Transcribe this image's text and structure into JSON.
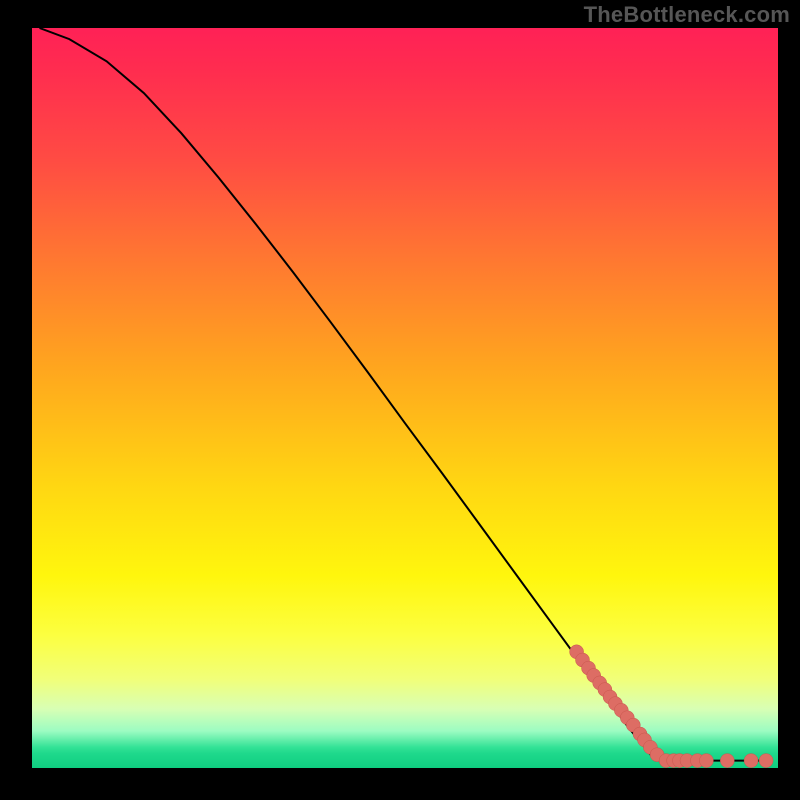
{
  "watermark": "TheBottleneck.com",
  "colors": {
    "grad_top": "#ff2156",
    "grad_mid": "#ffe012",
    "grad_low": "#33e296",
    "point": "#dd6d64",
    "line": "#000000",
    "bg": "#000000"
  },
  "chart_data": {
    "type": "line",
    "title": "",
    "xlabel": "",
    "ylabel": "",
    "xlim": [
      0,
      100
    ],
    "ylim": [
      0,
      100
    ],
    "grid": false,
    "legend": false,
    "curve": [
      {
        "x": 1,
        "y": 100
      },
      {
        "x": 5,
        "y": 98.5
      },
      {
        "x": 10,
        "y": 95.5
      },
      {
        "x": 15,
        "y": 91.2
      },
      {
        "x": 20,
        "y": 85.8
      },
      {
        "x": 25,
        "y": 79.8
      },
      {
        "x": 30,
        "y": 73.5
      },
      {
        "x": 35,
        "y": 67.0
      },
      {
        "x": 40,
        "y": 60.3
      },
      {
        "x": 45,
        "y": 53.5
      },
      {
        "x": 50,
        "y": 46.6
      },
      {
        "x": 55,
        "y": 39.8
      },
      {
        "x": 60,
        "y": 32.9
      },
      {
        "x": 65,
        "y": 26.0
      },
      {
        "x": 70,
        "y": 19.1
      },
      {
        "x": 75,
        "y": 12.2
      },
      {
        "x": 80,
        "y": 5.4
      },
      {
        "x": 83,
        "y": 1.7
      },
      {
        "x": 84.5,
        "y": 1.0
      },
      {
        "x": 90,
        "y": 1.0
      },
      {
        "x": 95,
        "y": 1.0
      },
      {
        "x": 99,
        "y": 1.0
      }
    ],
    "points": [
      {
        "x": 73.0,
        "y": 15.7
      },
      {
        "x": 73.8,
        "y": 14.6
      },
      {
        "x": 74.6,
        "y": 13.5
      },
      {
        "x": 75.3,
        "y": 12.5
      },
      {
        "x": 76.1,
        "y": 11.5
      },
      {
        "x": 76.8,
        "y": 10.6
      },
      {
        "x": 77.5,
        "y": 9.6
      },
      {
        "x": 78.2,
        "y": 8.7
      },
      {
        "x": 79.0,
        "y": 7.8
      },
      {
        "x": 79.8,
        "y": 6.8
      },
      {
        "x": 80.6,
        "y": 5.8
      },
      {
        "x": 81.5,
        "y": 4.6
      },
      {
        "x": 82.1,
        "y": 3.8
      },
      {
        "x": 82.9,
        "y": 2.8
      },
      {
        "x": 83.8,
        "y": 1.8
      },
      {
        "x": 85.0,
        "y": 1.0
      },
      {
        "x": 86.0,
        "y": 1.0
      },
      {
        "x": 86.8,
        "y": 1.0
      },
      {
        "x": 87.8,
        "y": 1.0
      },
      {
        "x": 89.2,
        "y": 1.0
      },
      {
        "x": 90.4,
        "y": 1.0
      },
      {
        "x": 93.2,
        "y": 1.0
      },
      {
        "x": 96.4,
        "y": 1.0
      },
      {
        "x": 98.4,
        "y": 1.0
      }
    ]
  }
}
